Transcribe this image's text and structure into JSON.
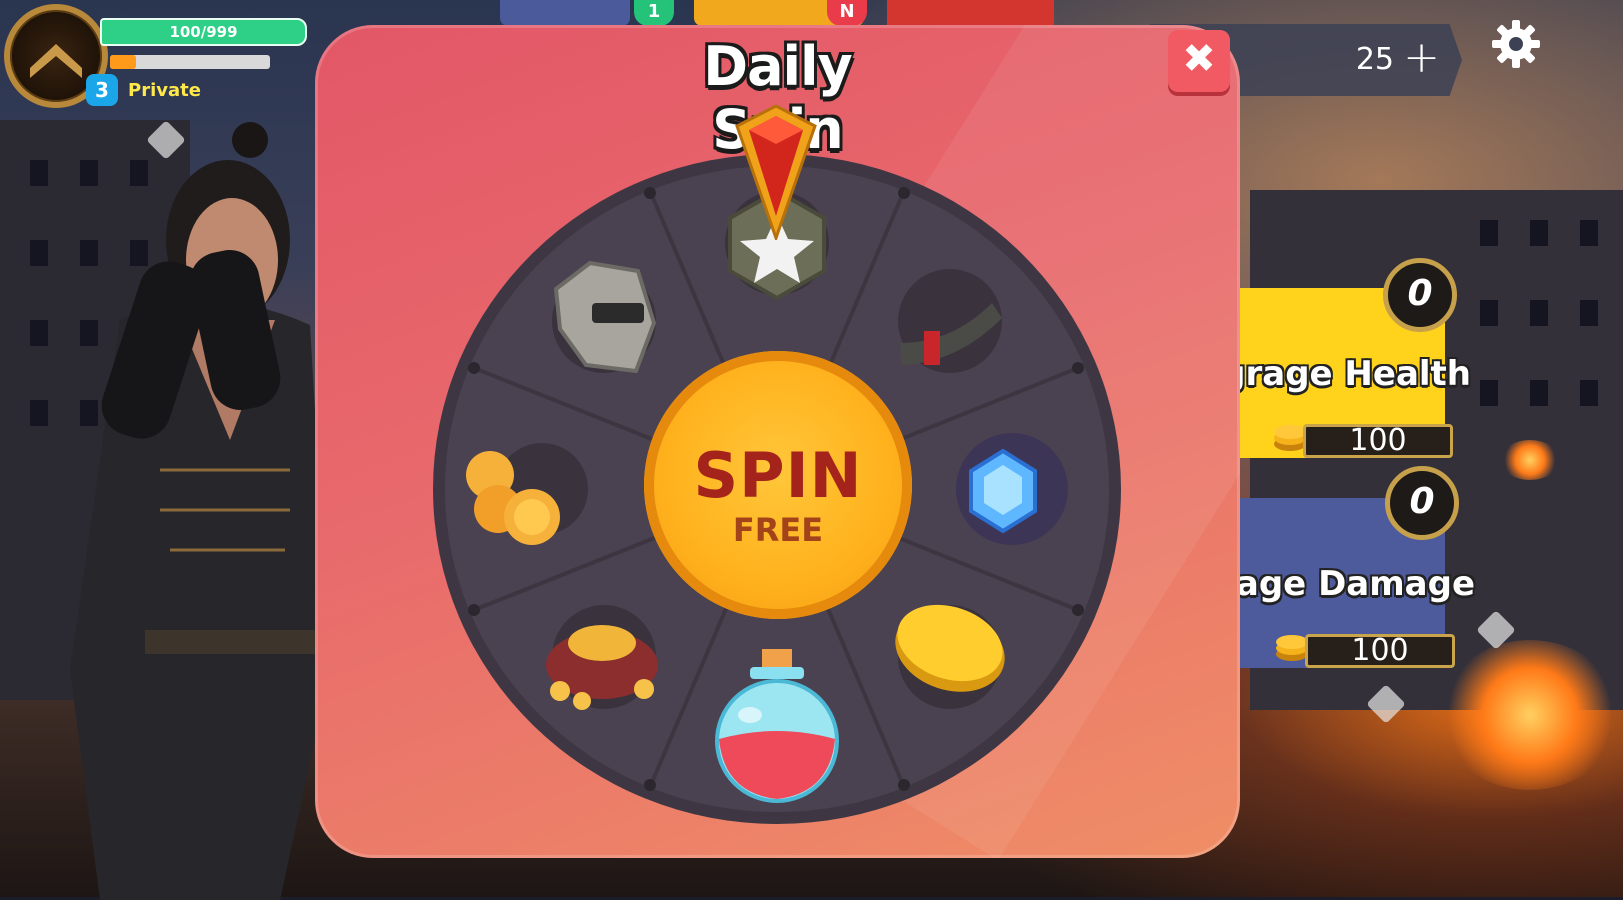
{
  "hud": {
    "hp_text": "100/999",
    "xp_progress": 0.16,
    "level": "3",
    "rank_name": "Private",
    "top_badges": [
      "1",
      "N"
    ],
    "currency_value": "25",
    "currency_plus": "+"
  },
  "upgrades": [
    {
      "title": "Upgrade Health",
      "visible_title": "grage Health",
      "level": "0",
      "cost": "100",
      "color": "#ffd21c"
    },
    {
      "title": "Upgrade Damage",
      "visible_title": "grage Damage",
      "level": "0",
      "cost": "100",
      "color": "#4d5a9c"
    }
  ],
  "modal": {
    "title": "Daily Spin",
    "close_icon": "close-x-icon",
    "spin_label": "SPIN",
    "spin_sub": "FREE"
  },
  "wheel": {
    "segments": [
      {
        "icon": "rank-star-icon"
      },
      {
        "icon": "ammo-magazine-icon"
      },
      {
        "icon": "blue-gem-icon"
      },
      {
        "icon": "gold-coin-icon"
      },
      {
        "icon": "health-potion-icon"
      },
      {
        "icon": "coin-bag-icon"
      },
      {
        "icon": "coin-stack-icon"
      },
      {
        "icon": "helmet-icon"
      }
    ]
  },
  "colors": {
    "modal": "#e35767",
    "spin": "#ffb21d",
    "close": "#f25a63",
    "hp": "#2ecf86",
    "xp": "#ff9a1a"
  }
}
